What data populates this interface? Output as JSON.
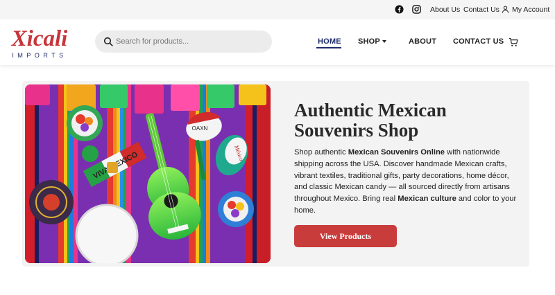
{
  "topbar": {
    "icons": [
      "facebook-icon",
      "instagram-icon",
      "user-icon"
    ],
    "links": {
      "about": "About Us",
      "contact": "Contact Us",
      "account": "My Account"
    }
  },
  "header": {
    "logo": {
      "main": "Xicali",
      "sub": "IMPORTS"
    },
    "search": {
      "placeholder": "Search for products..."
    },
    "nav": {
      "home": "HOME",
      "shop": "SHOP",
      "about": "ABOUT",
      "contact": "CONTACT US"
    },
    "cart_icon": "cart-icon"
  },
  "hero": {
    "title": "Authentic Mexican Souvenirs Shop",
    "text_1": "Shop authentic ",
    "bold_1": "Mexican Souvenirs Online",
    "text_2": " with nationwide shipping across the USA. Discover handmade Mexican crafts, vibrant textiles, traditional gifts, party decorations, home décor, and classic Mexican candy — all sourced directly from artisans throughout Mexico. Bring real ",
    "bold_2": "Mexican culture",
    "text_3": " and color to your home.",
    "cta": "View Products",
    "image_labels": {
      "maraca": "OAXN",
      "flag": "VIVA MEXICO",
      "maraca2": "México"
    }
  },
  "colors": {
    "brand_red": "#c93c3c",
    "brand_navy": "#1e2c6e",
    "card_bg": "#f3f3f3"
  }
}
